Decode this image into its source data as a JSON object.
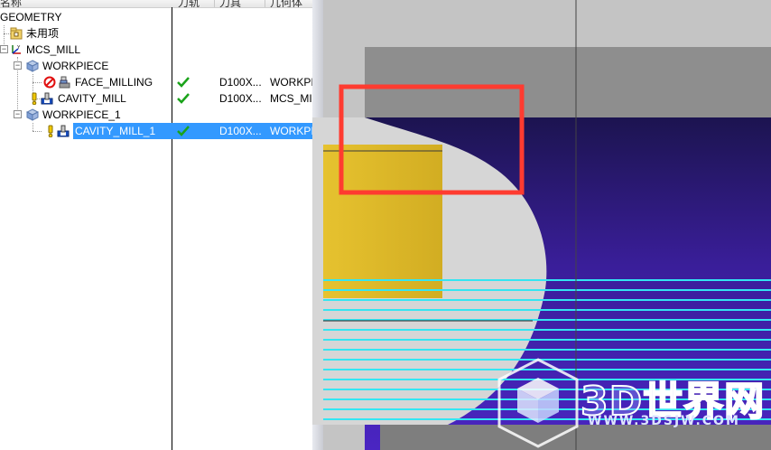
{
  "navigator": {
    "columns": [
      "名称",
      "刀轨",
      "刀具",
      "几何体"
    ],
    "rows": [
      {
        "name": "GEOMETRY",
        "path": "",
        "tool": "",
        "geom": ""
      },
      {
        "name": "未用项",
        "path": "",
        "tool": "",
        "geom": ""
      },
      {
        "name": "MCS_MILL",
        "path": "",
        "tool": "",
        "geom": ""
      },
      {
        "name": "WORKPIECE",
        "path": "",
        "tool": "",
        "geom": ""
      },
      {
        "name": "FACE_MILLING",
        "path": "✔",
        "tool": "D100X...",
        "geom": "WORKPI"
      },
      {
        "name": "CAVITY_MILL",
        "path": "✔",
        "tool": "D100X...",
        "geom": "MCS_MI"
      },
      {
        "name": "WORKPIECE_1",
        "path": "",
        "tool": "",
        "geom": ""
      },
      {
        "name": "CAVITY_MILL_1",
        "path": "✔",
        "tool": "D100X...",
        "geom": "WORKPI"
      }
    ]
  },
  "icons": {
    "geometry_root": "geometry-view-icon",
    "unused": "unused-items-folder-icon",
    "mcs": "mcs-coordinate-icon",
    "workpiece": "workpiece-cube-icon",
    "no_entry": "prohibited-icon",
    "warning": "warning-exclamation-icon",
    "operation": "cavity-mill-operation-icon",
    "check": "green-check-icon"
  },
  "watermark": {
    "title": "3D世界网",
    "url": "WWW.3DSJW.COM"
  },
  "colors": {
    "selection": "#3399ff",
    "highlight_box": "#ff3b30",
    "toolpath": "#33e6f2",
    "part_purple": "#3f1e9e",
    "stock_yellow": "#e2bf2e",
    "check_green": "#1aa31a"
  }
}
